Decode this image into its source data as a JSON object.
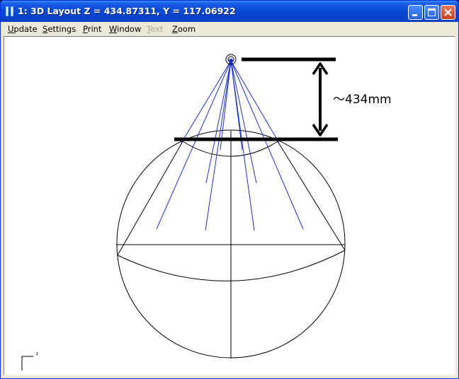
{
  "window": {
    "title": "1: 3D Layout Z = 434.87311, Y = 117.06922"
  },
  "menu": [
    {
      "label": "Update",
      "mnemonic": "U",
      "rest": "pdate",
      "enabled": true
    },
    {
      "label": "Settings",
      "mnemonic": "S",
      "rest": "ettings",
      "enabled": true
    },
    {
      "label": "Print",
      "mnemonic": "P",
      "rest": "rint",
      "enabled": true
    },
    {
      "label": "Window",
      "mnemonic": "W",
      "rest": "indow",
      "enabled": true
    },
    {
      "label": "Text",
      "mnemonic": "T",
      "rest": "ext",
      "enabled": false
    },
    {
      "label": "Zoom",
      "mnemonic": "Z",
      "rest": "oom",
      "enabled": true
    }
  ],
  "annotation": {
    "distance_label": "～434mm"
  },
  "axis_indicator": {
    "label": "z"
  },
  "colors": {
    "rays": "#1a2fd6",
    "outline": "#000000",
    "titlebar": "#0a4bd6"
  }
}
